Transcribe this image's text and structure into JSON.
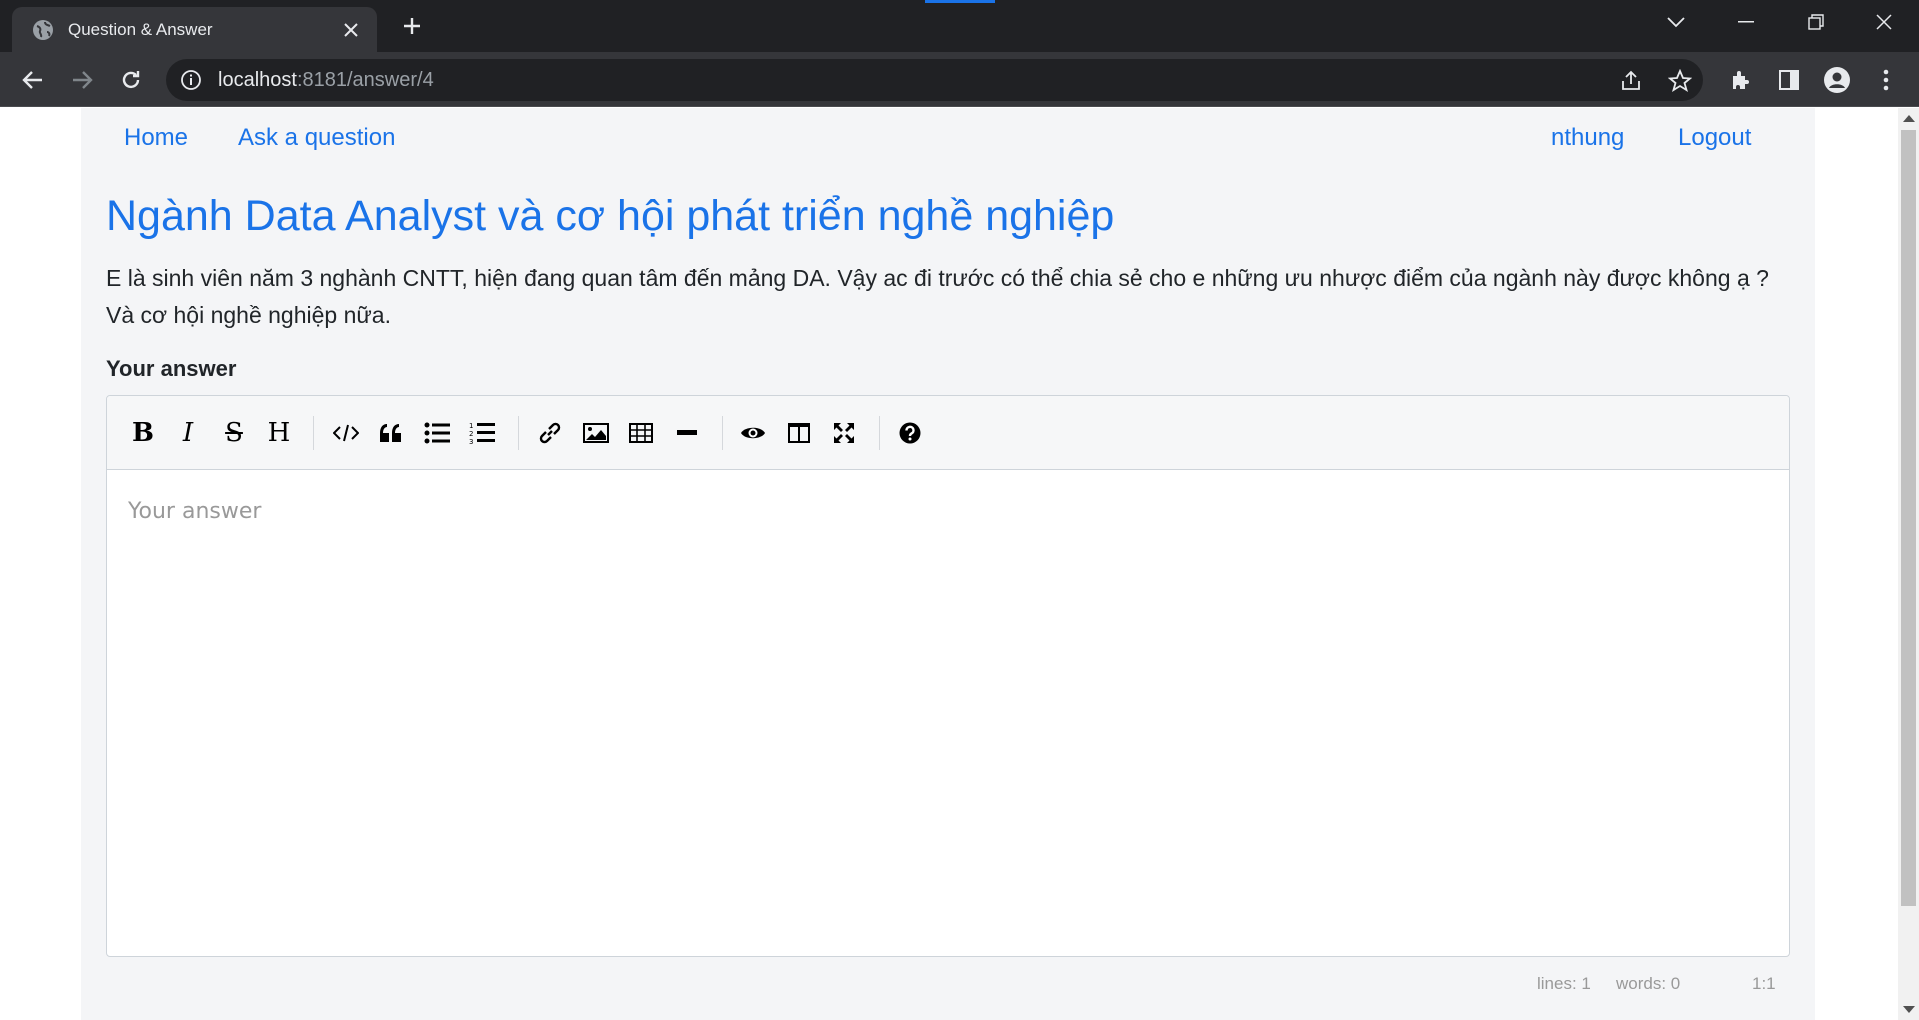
{
  "browser": {
    "tab_title": "Question & Answer",
    "url_host": "localhost",
    "url_rest": ":8181/answer/4"
  },
  "nav": {
    "home": "Home",
    "ask": "Ask a question",
    "user": "nthung",
    "logout": "Logout"
  },
  "question": {
    "title": "Ngành Data Analyst và cơ hội phát triển nghề nghiệp",
    "body": "E là sinh viên năm 3 nghành CNTT, hiện đang quan tâm đến mảng DA. Vậy ac đi trước có thể chia sẻ cho e những ưu nhược điểm của ngành này được không ạ ? Và cơ hội nghề nghiệp nữa."
  },
  "answer": {
    "label": "Your answer",
    "placeholder": "Your answer",
    "value": ""
  },
  "editor": {
    "toolbar_icons": [
      "bold-icon",
      "italic-icon",
      "strikethrough-icon",
      "heading-icon",
      "code-icon",
      "quote-icon",
      "unordered-list-icon",
      "ordered-list-icon",
      "link-icon",
      "image-icon",
      "table-icon",
      "horizontal-rule-icon",
      "preview-icon",
      "side-by-side-icon",
      "fullscreen-icon",
      "guide-icon"
    ],
    "status": {
      "lines": "lines: 1",
      "words": "words: 0",
      "cursor": "1:1"
    }
  },
  "colors": {
    "link": "#1a73e8",
    "chrome_dark": "#202124",
    "chrome_mid": "#35363a",
    "page_bg": "#f4f5f7"
  }
}
